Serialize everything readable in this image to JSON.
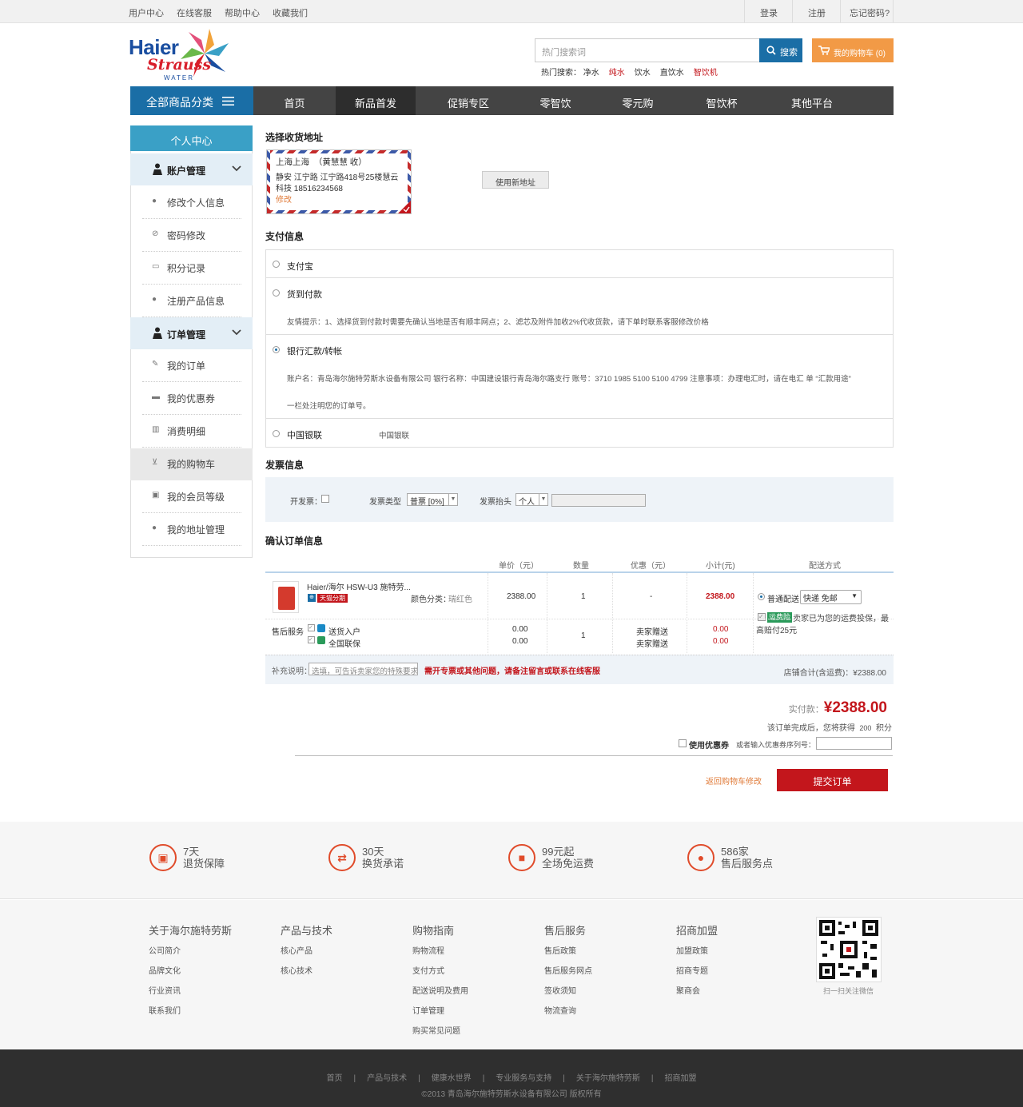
{
  "topbar": {
    "left_links": [
      "用户中心",
      "在线客服",
      "帮助中心",
      "收藏我们"
    ],
    "right_links": [
      "登录",
      "注册",
      "忘记密码?"
    ]
  },
  "logo": {
    "line1": "Haier",
    "line2": "Strauss",
    "line3": "WATER"
  },
  "search": {
    "placeholder": "热门搜索词",
    "button": "搜索",
    "hot_label": "热门搜索：",
    "hot_terms": [
      {
        "text": "净水",
        "color": "#333333"
      },
      {
        "text": "纯水",
        "color": "#c3161c"
      },
      {
        "text": "饮水",
        "color": "#333333"
      },
      {
        "text": "直饮水",
        "color": "#333333"
      },
      {
        "text": "智饮机",
        "color": "#c3161c"
      }
    ]
  },
  "cart": {
    "label": "我的购物车 (0)"
  },
  "nav": {
    "all_label": "全部商品分类",
    "items": [
      "首页",
      "新品首发",
      "促销专区",
      "零智饮",
      "零元购",
      "智饮杯",
      "其他平台"
    ],
    "active_index": 1
  },
  "sidebar": {
    "title": "个人中心",
    "groups": [
      {
        "label": "账户管理",
        "icon": "user-icon",
        "items": [
          {
            "label": "修改个人信息",
            "icon": "user-small-icon"
          },
          {
            "label": "密码修改",
            "icon": "lock-icon"
          },
          {
            "label": "积分记录",
            "icon": "monitor-icon"
          },
          {
            "label": "注册产品信息",
            "icon": "pin-icon"
          }
        ]
      },
      {
        "label": "订单管理",
        "icon": "user-icon",
        "items": [
          {
            "label": "我的订单",
            "icon": "edit-icon"
          },
          {
            "label": "我的优惠券",
            "icon": "coupon-icon"
          },
          {
            "label": "消费明细",
            "icon": "list-icon"
          },
          {
            "label": "我的购物车",
            "icon": "cart-icon"
          },
          {
            "label": "我的会员等级",
            "icon": "badge-icon"
          },
          {
            "label": "我的地址管理",
            "icon": "pin-icon"
          }
        ]
      }
    ],
    "active_item": "我的购物车"
  },
  "address": {
    "title": "选择收货地址",
    "region": "上海上海",
    "receiver": "（黄慧慧 收）",
    "detail": "静安 江宁路 江宁路418号25楼慧云科技 18516234568",
    "edit": "修改",
    "new_button": "使用新地址"
  },
  "payment": {
    "title": "支付信息",
    "options": [
      {
        "label": "支付宝",
        "selected": false
      },
      {
        "label": "货到付款",
        "selected": false,
        "note": "友情提示：1、选择货到付款时需要先确认当地是否有顺丰网点；2、滤芯及附件加收2%代收货款，请下单时联系客服修改价格"
      },
      {
        "label": "银行汇款/转帐",
        "selected": true,
        "note": "账户名：青岛海尔施特劳斯水设备有限公司 银行名称：中国建设银行青岛海尔路支行 账号：3710 1985 5100 5100 4799 注意事项：办理电汇时，请在电汇 单 “汇款用途”",
        "note2": "一栏处注明您的订单号。"
      },
      {
        "label": "中国银联",
        "selected": false,
        "extra": "中国银联"
      }
    ]
  },
  "invoice": {
    "title": "发票信息",
    "open_label": "开发票：",
    "type_label": "发票类型",
    "type_value": "普票 [0%]",
    "head_label": "发票抬头",
    "head_value": "个人"
  },
  "order": {
    "title": "确认订单信息",
    "columns": [
      "单价（元）",
      "数量",
      "优惠（元）",
      "小计(元)",
      "配送方式"
    ],
    "product": {
      "name": "Haier/海尔 HSW-U3 施特劳...",
      "badge": "天猫分期",
      "color_label": "颜色分类：",
      "color_value": "瑞红色",
      "price": "2388.00",
      "qty": "1",
      "discount": "-",
      "subtotal": "2388.00",
      "delivery_label": "普通配送",
      "delivery_value": "快递 免邮",
      "insurance_badge": "运费险",
      "insurance_text": "卖家已为您的运费投保，最高赔付25元"
    },
    "after_sale": {
      "label": "售后服务",
      "items": [
        {
          "label": "送货入户",
          "price": "0.00",
          "by": "卖家赠送",
          "subtotal": "0.00"
        },
        {
          "label": "全国联保",
          "price": "0.00",
          "by": "卖家赠送",
          "subtotal": "0.00"
        }
      ],
      "qty": "1"
    },
    "remark_label": "补充说明：",
    "remark_placeholder": "选填，可告诉卖家您的特殊要求",
    "remark_notice": "需开专票或其他问题，请备注留言或联系在线客服",
    "shop_total": "店铺合计(含运费)：¥2388.00"
  },
  "summary": {
    "pay_label": "实付款：",
    "pay_amount": "¥2388.00",
    "points_text": "该订单完成后，您将获得",
    "points_value": "200",
    "points_unit": "积分",
    "coupon_label": "使用优惠券",
    "coupon_input_label": "或者输入优惠券序列号：",
    "back_link": "返回购物车修改",
    "submit": "提交订单"
  },
  "services": [
    {
      "line1": "7天",
      "line2": "退货保障",
      "icon": "bag-icon"
    },
    {
      "line1": "30天",
      "line2": "换货承诺",
      "icon": "exchange-icon"
    },
    {
      "line1": "99元起",
      "line2": "全场免运费",
      "icon": "truck-icon"
    },
    {
      "line1": "586家",
      "line2": "售后服务点",
      "icon": "location-icon"
    }
  ],
  "footer": {
    "columns": [
      {
        "title": "关于海尔施特劳斯",
        "items": [
          "公司简介",
          "品牌文化",
          "行业资讯",
          "联系我们"
        ]
      },
      {
        "title": "产品与技术",
        "items": [
          "核心产品",
          "核心技术"
        ]
      },
      {
        "title": "购物指南",
        "items": [
          "购物流程",
          "支付方式",
          "配送说明及费用",
          "订单管理",
          "购买常见问题"
        ]
      },
      {
        "title": "售后服务",
        "items": [
          "售后政策",
          "售后服务网点",
          "签收须知",
          "物流查询"
        ]
      },
      {
        "title": "招商加盟",
        "items": [
          "加盟政策",
          "招商专题",
          "聚商会"
        ]
      }
    ],
    "qr_caption": "扫一扫关注微信",
    "bottom_links": [
      "首页",
      "产品与技术",
      "健康水世界",
      "专业服务与支持",
      "关于海尔施特劳斯",
      "招商加盟"
    ],
    "copyright": "©2013 青岛海尔施特劳斯水设备有限公司 版权所有"
  }
}
